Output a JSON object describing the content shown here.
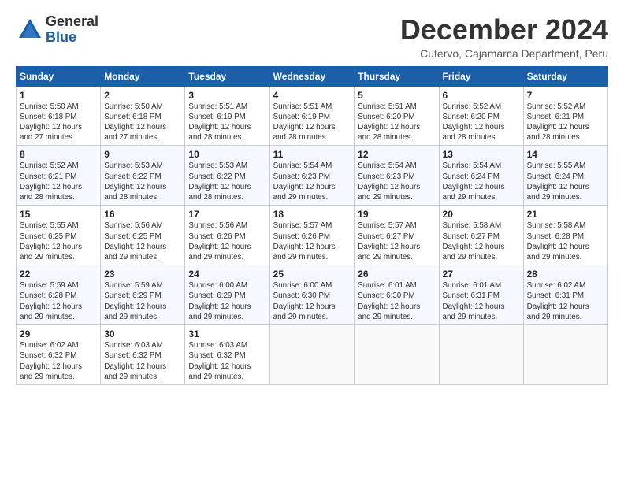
{
  "logo": {
    "general": "General",
    "blue": "Blue"
  },
  "title": "December 2024",
  "subtitle": "Cutervo, Cajamarca Department, Peru",
  "weekdays": [
    "Sunday",
    "Monday",
    "Tuesday",
    "Wednesday",
    "Thursday",
    "Friday",
    "Saturday"
  ],
  "weeks": [
    [
      {
        "day": "1",
        "info": "Sunrise: 5:50 AM\nSunset: 6:18 PM\nDaylight: 12 hours\nand 27 minutes."
      },
      {
        "day": "2",
        "info": "Sunrise: 5:50 AM\nSunset: 6:18 PM\nDaylight: 12 hours\nand 27 minutes."
      },
      {
        "day": "3",
        "info": "Sunrise: 5:51 AM\nSunset: 6:19 PM\nDaylight: 12 hours\nand 28 minutes."
      },
      {
        "day": "4",
        "info": "Sunrise: 5:51 AM\nSunset: 6:19 PM\nDaylight: 12 hours\nand 28 minutes."
      },
      {
        "day": "5",
        "info": "Sunrise: 5:51 AM\nSunset: 6:20 PM\nDaylight: 12 hours\nand 28 minutes."
      },
      {
        "day": "6",
        "info": "Sunrise: 5:52 AM\nSunset: 6:20 PM\nDaylight: 12 hours\nand 28 minutes."
      },
      {
        "day": "7",
        "info": "Sunrise: 5:52 AM\nSunset: 6:21 PM\nDaylight: 12 hours\nand 28 minutes."
      }
    ],
    [
      {
        "day": "8",
        "info": "Sunrise: 5:52 AM\nSunset: 6:21 PM\nDaylight: 12 hours\nand 28 minutes."
      },
      {
        "day": "9",
        "info": "Sunrise: 5:53 AM\nSunset: 6:22 PM\nDaylight: 12 hours\nand 28 minutes."
      },
      {
        "day": "10",
        "info": "Sunrise: 5:53 AM\nSunset: 6:22 PM\nDaylight: 12 hours\nand 28 minutes."
      },
      {
        "day": "11",
        "info": "Sunrise: 5:54 AM\nSunset: 6:23 PM\nDaylight: 12 hours\nand 29 minutes."
      },
      {
        "day": "12",
        "info": "Sunrise: 5:54 AM\nSunset: 6:23 PM\nDaylight: 12 hours\nand 29 minutes."
      },
      {
        "day": "13",
        "info": "Sunrise: 5:54 AM\nSunset: 6:24 PM\nDaylight: 12 hours\nand 29 minutes."
      },
      {
        "day": "14",
        "info": "Sunrise: 5:55 AM\nSunset: 6:24 PM\nDaylight: 12 hours\nand 29 minutes."
      }
    ],
    [
      {
        "day": "15",
        "info": "Sunrise: 5:55 AM\nSunset: 6:25 PM\nDaylight: 12 hours\nand 29 minutes."
      },
      {
        "day": "16",
        "info": "Sunrise: 5:56 AM\nSunset: 6:25 PM\nDaylight: 12 hours\nand 29 minutes."
      },
      {
        "day": "17",
        "info": "Sunrise: 5:56 AM\nSunset: 6:26 PM\nDaylight: 12 hours\nand 29 minutes."
      },
      {
        "day": "18",
        "info": "Sunrise: 5:57 AM\nSunset: 6:26 PM\nDaylight: 12 hours\nand 29 minutes."
      },
      {
        "day": "19",
        "info": "Sunrise: 5:57 AM\nSunset: 6:27 PM\nDaylight: 12 hours\nand 29 minutes."
      },
      {
        "day": "20",
        "info": "Sunrise: 5:58 AM\nSunset: 6:27 PM\nDaylight: 12 hours\nand 29 minutes."
      },
      {
        "day": "21",
        "info": "Sunrise: 5:58 AM\nSunset: 6:28 PM\nDaylight: 12 hours\nand 29 minutes."
      }
    ],
    [
      {
        "day": "22",
        "info": "Sunrise: 5:59 AM\nSunset: 6:28 PM\nDaylight: 12 hours\nand 29 minutes."
      },
      {
        "day": "23",
        "info": "Sunrise: 5:59 AM\nSunset: 6:29 PM\nDaylight: 12 hours\nand 29 minutes."
      },
      {
        "day": "24",
        "info": "Sunrise: 6:00 AM\nSunset: 6:29 PM\nDaylight: 12 hours\nand 29 minutes."
      },
      {
        "day": "25",
        "info": "Sunrise: 6:00 AM\nSunset: 6:30 PM\nDaylight: 12 hours\nand 29 minutes."
      },
      {
        "day": "26",
        "info": "Sunrise: 6:01 AM\nSunset: 6:30 PM\nDaylight: 12 hours\nand 29 minutes."
      },
      {
        "day": "27",
        "info": "Sunrise: 6:01 AM\nSunset: 6:31 PM\nDaylight: 12 hours\nand 29 minutes."
      },
      {
        "day": "28",
        "info": "Sunrise: 6:02 AM\nSunset: 6:31 PM\nDaylight: 12 hours\nand 29 minutes."
      }
    ],
    [
      {
        "day": "29",
        "info": "Sunrise: 6:02 AM\nSunset: 6:32 PM\nDaylight: 12 hours\nand 29 minutes."
      },
      {
        "day": "30",
        "info": "Sunrise: 6:03 AM\nSunset: 6:32 PM\nDaylight: 12 hours\nand 29 minutes."
      },
      {
        "day": "31",
        "info": "Sunrise: 6:03 AM\nSunset: 6:32 PM\nDaylight: 12 hours\nand 29 minutes."
      },
      {
        "day": "",
        "info": ""
      },
      {
        "day": "",
        "info": ""
      },
      {
        "day": "",
        "info": ""
      },
      {
        "day": "",
        "info": ""
      }
    ]
  ]
}
